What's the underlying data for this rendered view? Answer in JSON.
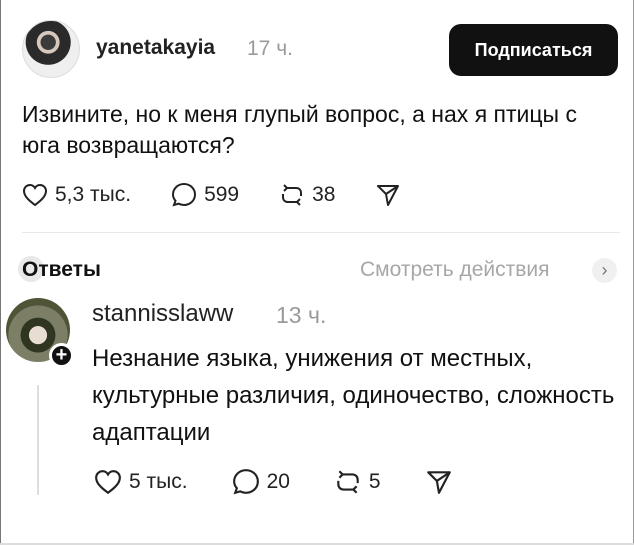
{
  "post": {
    "username": "yanetakayia",
    "time": "17 ч.",
    "follow_label": "Подписаться",
    "text": "Извините, но к меня глупый вопрос, а нах  я птицы с юга возвращаются?",
    "actions": {
      "likes": "5,3 тыс.",
      "comments": "599",
      "reposts": "38"
    }
  },
  "replies_section": {
    "title": "Ответы",
    "see_activity": "Смотреть действия"
  },
  "reply": {
    "username": "stannisslaww",
    "time": "13 ч.",
    "text": "Незнание языка, унижения от местных, культурные различия, одиночество, сложность адаптации",
    "actions": {
      "likes": "5 тыс.",
      "comments": "20",
      "reposts": "5"
    }
  },
  "icons": {
    "heart": "heart-icon",
    "comment": "comment-bubble-icon",
    "repost": "repost-icon",
    "share": "share-send-icon",
    "follow_plus": "plus-icon",
    "chevron": "chevron-right-icon"
  }
}
